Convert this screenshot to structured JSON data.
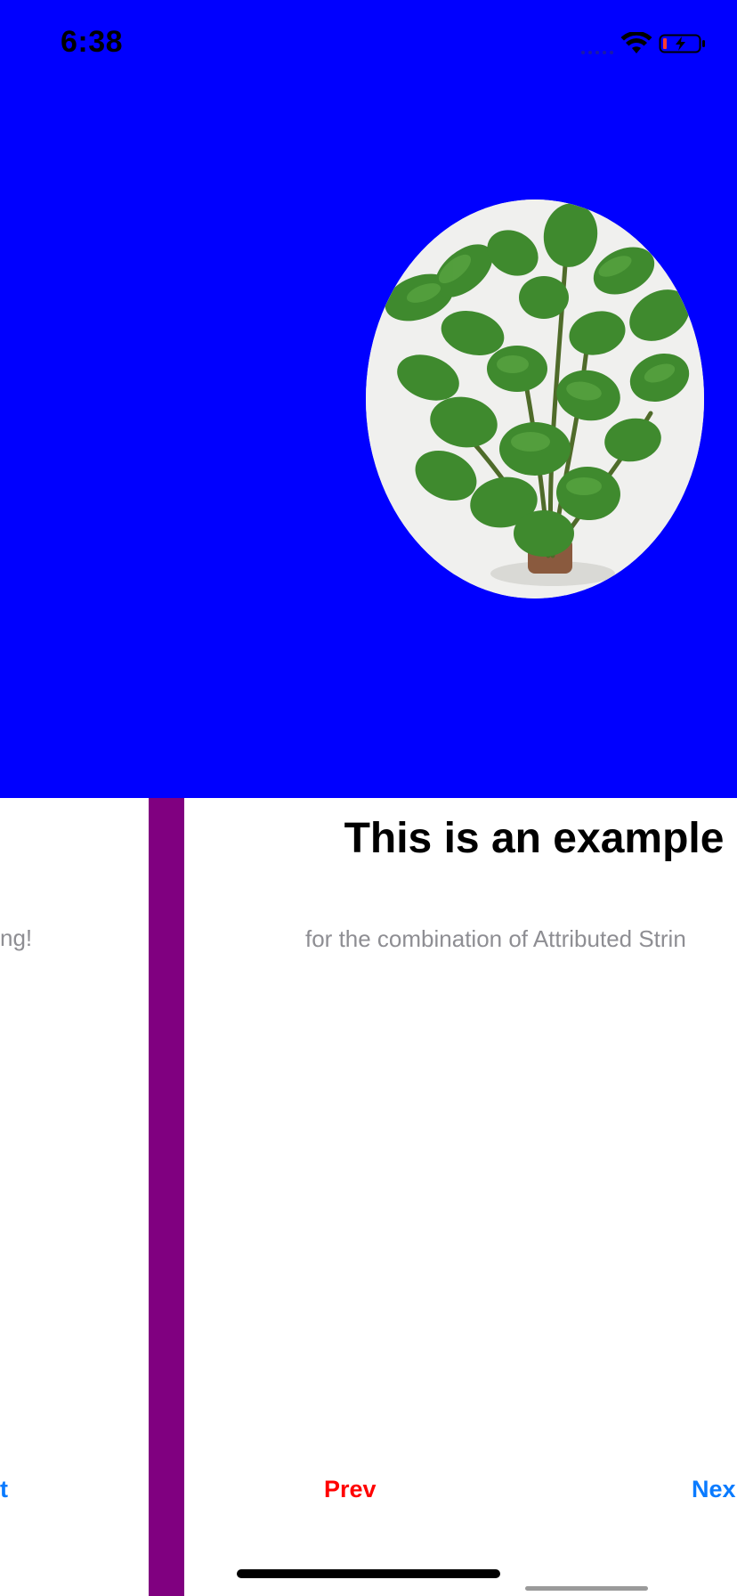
{
  "status_bar": {
    "time": "6:38",
    "signal_icon": "signal-icon",
    "wifi_icon": "wifi-icon",
    "battery_icon": "battery-charging-icon"
  },
  "hero": {
    "background_color": "#0000ff",
    "image": "plant-photo"
  },
  "previous_page": {
    "subtitle_fragment": "ng!",
    "next_fragment": "t"
  },
  "page": {
    "title": "This is an example",
    "subtitle": "for the combination of Attributed Strin",
    "prev_label": "Prev",
    "next_label": "Nex"
  },
  "colors": {
    "divider": "#800080",
    "prev": "#ff0000",
    "next": "#0a7bff",
    "subtitle": "#8e8e93"
  }
}
